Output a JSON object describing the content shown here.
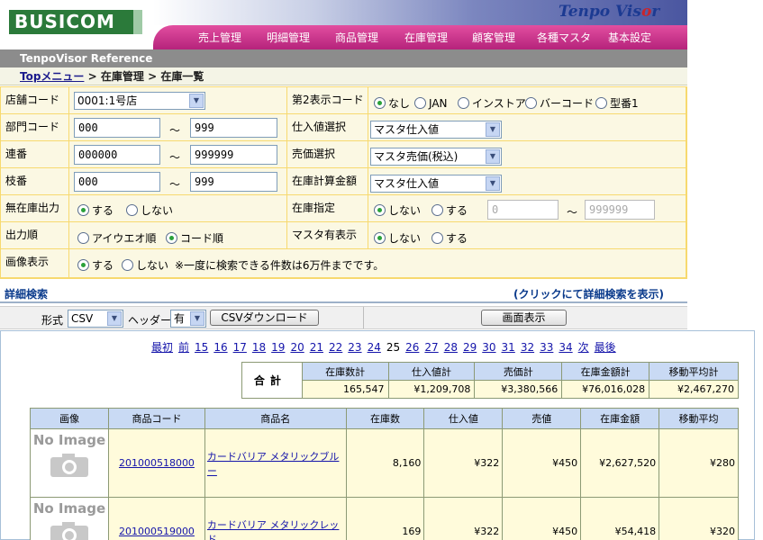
{
  "app": {
    "logo": "BUSICOM",
    "brand_a": "Tenpo Vis",
    "brand_b": "o",
    "brand_c": "r",
    "subtitle": "TenpoVisor Reference"
  },
  "nav": [
    "売上管理",
    "明細管理",
    "商品管理",
    "在庫管理",
    "顧客管理",
    "各種マスタ",
    "基本設定"
  ],
  "breadcrumb": {
    "link": "Topメニュー",
    "sep1": ">",
    "mid": "在庫管理",
    "sep2": ">",
    "current": "在庫一覧"
  },
  "form": {
    "store_label": "店舗コード",
    "store_value": "0001:1号店",
    "dept_label": "部門コード",
    "dept_from": "000",
    "dept_to": "999",
    "serial_label": "連番",
    "serial_from": "000000",
    "serial_to": "999999",
    "branch_label": "枝番",
    "branch_from": "000",
    "branch_to": "999",
    "nostock_label": "無在庫出力",
    "nostock_opts": [
      "する",
      "しない"
    ],
    "order_label": "出力順",
    "order_opts": [
      "アイウエオ順",
      "コード順"
    ],
    "image_label": "画像表示",
    "image_opts": [
      "する",
      "しない"
    ],
    "image_note": "※一度に検索できる件数は6万件までです。",
    "second_label": "第2表示コード",
    "second_opts": [
      "なし",
      "JAN",
      "インストア",
      "バーコード",
      "型番1"
    ],
    "cost_label": "仕入値選択",
    "cost_value": "マスタ仕入値",
    "price_label": "売価選択",
    "price_value": "マスタ売価(税込)",
    "stockcalc_label": "在庫計算金額",
    "stockcalc_value": "マスタ仕入値",
    "stockspec_label": "在庫指定",
    "stockspec_opts": [
      "しない",
      "する"
    ],
    "stockspec_from": "0",
    "stockspec_to": "999999",
    "master_label": "マスタ有表示",
    "master_opts": [
      "しない",
      "する"
    ],
    "tilde": "～"
  },
  "advanced": {
    "label": "詳細検索",
    "hint": "(クリックにて詳細検索を表示)"
  },
  "csv": {
    "format_label": "形式",
    "format_value": "CSV",
    "header_label": "ヘッダー",
    "header_value": "有",
    "download": "CSVダウンロード",
    "display": "画面表示"
  },
  "pager": {
    "first": "最初",
    "prev": "前",
    "pages": [
      "15",
      "16",
      "17",
      "18",
      "19",
      "20",
      "21",
      "22",
      "23",
      "24"
    ],
    "current": "25",
    "pages_after": [
      "26",
      "27",
      "28",
      "29",
      "30",
      "31",
      "32",
      "33",
      "34"
    ],
    "next": "次",
    "last": "最後"
  },
  "totals": {
    "label": "合計",
    "headers": [
      "在庫数計",
      "仕入値計",
      "売価計",
      "在庫金額計",
      "移動平均計"
    ],
    "values": [
      "165,547",
      "¥1,209,708",
      "¥3,380,566",
      "¥76,016,028",
      "¥2,467,270"
    ]
  },
  "items": {
    "headers": [
      "画像",
      "商品コード",
      "商品名",
      "在庫数",
      "仕入値",
      "売値",
      "在庫金額",
      "移動平均"
    ],
    "noimage": "No Image",
    "rows": [
      {
        "code": "201000518000",
        "name": "カードバリア メタリックブルー",
        "stock": "8,160",
        "cost": "¥322",
        "price": "¥450",
        "amount": "¥2,627,520",
        "avg": "¥280"
      },
      {
        "code": "201000519000",
        "name": "カードバリア メタリックレッド",
        "stock": "169",
        "cost": "¥322",
        "price": "¥450",
        "amount": "¥54,418",
        "avg": "¥320"
      }
    ]
  }
}
